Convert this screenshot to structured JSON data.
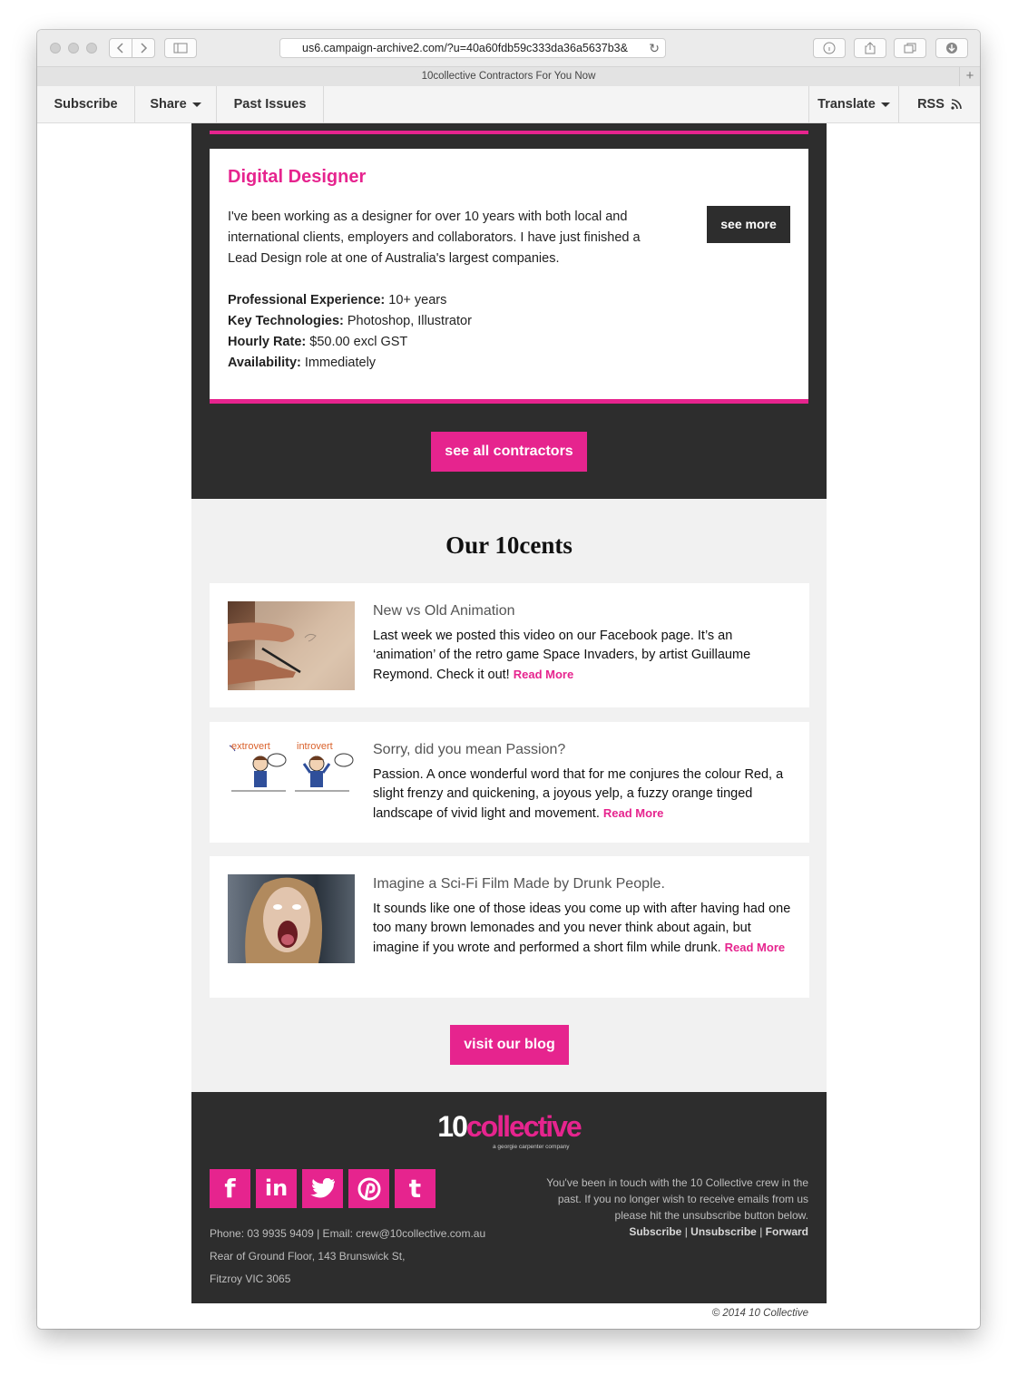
{
  "browser": {
    "url": "us6.campaign-archive2.com/?u=40a60fdb59c333da36a5637b3&",
    "tab_title": "10collective Contractors For You Now"
  },
  "topbar": {
    "subscribe": "Subscribe",
    "share": "Share",
    "past_issues": "Past Issues",
    "translate": "Translate",
    "rss": "RSS"
  },
  "contractor": {
    "title": "Digital Designer",
    "description": "I've been working as a designer for over 10 years with both local and international clients, employers and collaborators. I have just finished a Lead Design role at one of Australia's largest companies.",
    "see_more": "see more",
    "fields": [
      {
        "label": "Professional Experience:",
        "value": "10+ years"
      },
      {
        "label": "Key Technologies:",
        "value": "Photoshop, Illustrator"
      },
      {
        "label": "Hourly Rate:",
        "value": "$50.00 excl GST"
      },
      {
        "label": "Availability:",
        "value": "Immediately"
      }
    ],
    "see_all": "see all contractors"
  },
  "blog": {
    "heading": "Our 10cents",
    "read_more": "Read More",
    "posts": [
      {
        "title": "New vs Old Animation",
        "text": "Last week we posted this video on our Facebook page. It’s an ‘animation’ of the retro game Space Invaders, by artist Guillaume Reymond. Check it out!"
      },
      {
        "title": "Sorry, did you mean Passion?",
        "text": "Passion. A once wonderful word that for me conjures the colour Red, a slight frenzy and quickening, a joyous yelp, a fuzzy orange tinged landscape of vivid light and movement.",
        "img_left_label": "extrovert",
        "img_right_label": "introvert"
      },
      {
        "title": "Imagine a Sci-Fi Film Made by Drunk People.",
        "text": "It sounds like one of those ideas you come up with after having had one too many brown lemonades and you never think about again, but imagine if you wrote and performed a short film while drunk."
      }
    ],
    "visit_blog": "visit our blog"
  },
  "footer": {
    "logo_num": "10",
    "logo_word": "collective",
    "logo_tagline": "a georgie carpenter company",
    "social": [
      {
        "icon": "facebook-icon",
        "glyph": "f"
      },
      {
        "icon": "linkedin-icon",
        "glyph": "in"
      },
      {
        "icon": "twitter-icon",
        "glyph": ""
      },
      {
        "icon": "pinterest-icon",
        "glyph": ""
      },
      {
        "icon": "tumblr-icon",
        "glyph": "t"
      }
    ],
    "contact": "Phone: 03 9935 9409 | Email: crew@10collective.com.au",
    "address_line1": "Rear of Ground Floor, 143 Brunswick St,",
    "address_line2": "Fitzroy VIC 3065",
    "notice": "You've been in touch with the 10 Collective crew in the past. If you no longer wish to receive emails from us please hit the unsubscribe button below.",
    "links": {
      "subscribe": "Subscribe",
      "sep": "|",
      "unsubscribe": "Unsubscribe",
      "forward": "Forward"
    },
    "copyright": "© 2014 10 Collective"
  },
  "colors": {
    "accent": "#e6248e",
    "dark": "#2d2d2d",
    "light_bg": "#f1f1f1"
  }
}
